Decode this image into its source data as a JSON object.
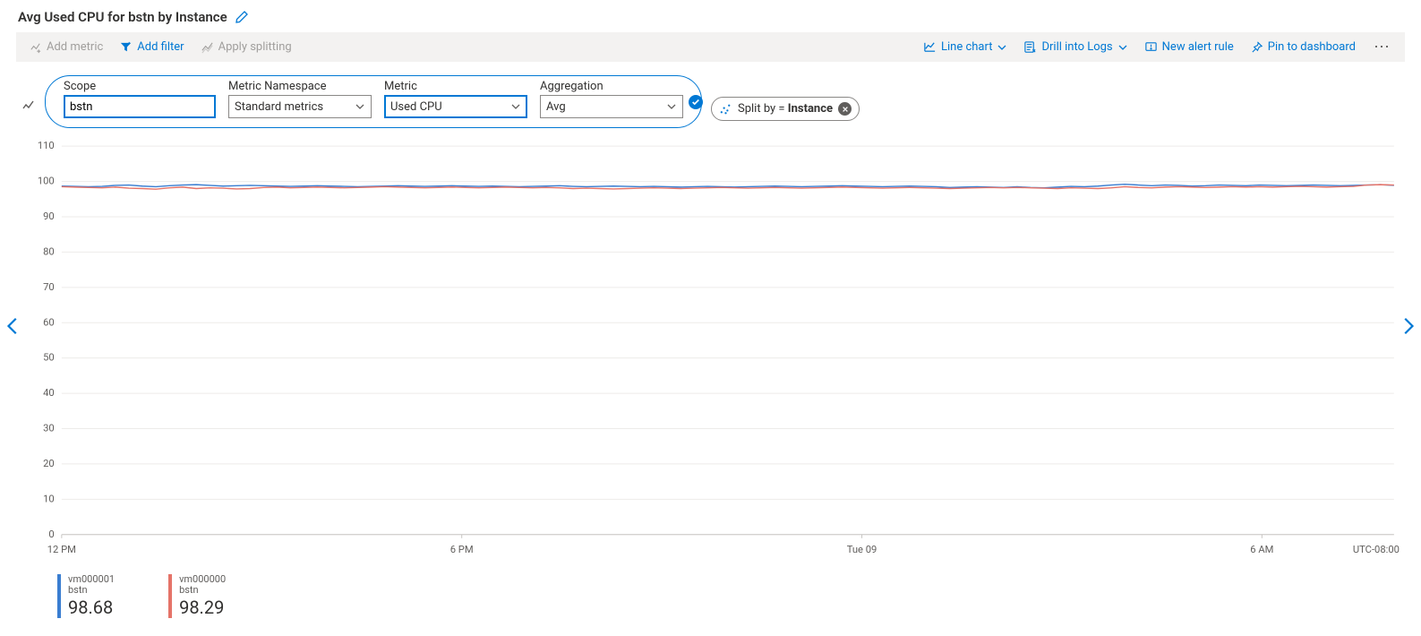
{
  "title": "Avg Used CPU for bstn by Instance",
  "toolbar": {
    "add_metric": "Add metric",
    "add_filter": "Add filter",
    "apply_splitting": "Apply splitting",
    "line_chart": "Line chart",
    "drill_logs": "Drill into Logs",
    "new_alert": "New alert rule",
    "pin_dashboard": "Pin to dashboard"
  },
  "config": {
    "scope_label": "Scope",
    "scope_value": "bstn",
    "namespace_label": "Metric Namespace",
    "namespace_value": "Standard metrics",
    "metric_label": "Metric",
    "metric_value": "Used CPU",
    "aggregation_label": "Aggregation",
    "aggregation_value": "Avg"
  },
  "split": {
    "prefix": "Split by = ",
    "value": "Instance"
  },
  "timezone": "UTC-08:00",
  "chart_data": {
    "type": "line",
    "title": "Avg Used CPU for bstn by Instance",
    "xlabel": "",
    "ylabel": "",
    "ylim": [
      0,
      110
    ],
    "y_ticks": [
      0,
      10,
      20,
      30,
      40,
      50,
      60,
      70,
      80,
      90,
      100,
      110
    ],
    "x_ticks": [
      "12 PM",
      "6 PM",
      "Tue 09",
      "6 AM"
    ],
    "x_range_hours": 24,
    "series": [
      {
        "name": "vm000001",
        "resource": "bstn",
        "color": "#3a7ed1",
        "avg": 98.68,
        "values": [
          98.7,
          98.6,
          98.5,
          98.6,
          98.9,
          99.0,
          98.7,
          98.5,
          98.8,
          99.0,
          99.1,
          98.9,
          98.7,
          98.8,
          98.9,
          98.8,
          98.7,
          98.6,
          98.7,
          98.8,
          98.7,
          98.6,
          98.5,
          98.6,
          98.7,
          98.8,
          98.7,
          98.6,
          98.7,
          98.8,
          98.7,
          98.6,
          98.7,
          98.6,
          98.5,
          98.6,
          98.7,
          98.8,
          98.6,
          98.5,
          98.6,
          98.7,
          98.6,
          98.5,
          98.6,
          98.5,
          98.4,
          98.5,
          98.6,
          98.5,
          98.4,
          98.5,
          98.6,
          98.7,
          98.6,
          98.5,
          98.6,
          98.7,
          98.8,
          98.7,
          98.6,
          98.5,
          98.6,
          98.7,
          98.6,
          98.5,
          98.3,
          98.4,
          98.5,
          98.4,
          98.3,
          98.5,
          98.3,
          98.2,
          98.4,
          98.6,
          98.5,
          98.7,
          99.0,
          99.2,
          99.0,
          98.8,
          99.0,
          98.9,
          98.7,
          98.8,
          99.0,
          98.9,
          98.8,
          99.0,
          98.9,
          98.8,
          98.9,
          99.0,
          98.9,
          98.8,
          98.9,
          99.0,
          99.1,
          98.9
        ]
      },
      {
        "name": "vm000000",
        "resource": "bstn",
        "color": "#e57368",
        "avg": 98.29,
        "values": [
          98.5,
          98.4,
          98.3,
          98.2,
          98.4,
          98.1,
          98.0,
          97.8,
          98.2,
          98.4,
          98.0,
          98.2,
          98.1,
          97.9,
          98.0,
          98.3,
          98.4,
          98.2,
          98.3,
          98.4,
          98.3,
          98.2,
          98.3,
          98.4,
          98.5,
          98.4,
          98.3,
          98.2,
          98.3,
          98.4,
          98.3,
          98.2,
          98.3,
          98.4,
          98.3,
          98.2,
          98.3,
          98.2,
          98.0,
          98.1,
          98.0,
          97.9,
          98.0,
          98.1,
          98.2,
          98.1,
          98.0,
          98.1,
          98.2,
          98.3,
          98.2,
          98.1,
          98.2,
          98.3,
          98.2,
          98.1,
          98.2,
          98.3,
          98.4,
          98.3,
          98.2,
          98.1,
          98.2,
          98.3,
          98.2,
          98.1,
          98.0,
          98.1,
          98.2,
          98.3,
          98.2,
          98.3,
          98.2,
          98.1,
          98.0,
          98.2,
          98.1,
          98.0,
          98.2,
          98.5,
          98.3,
          98.2,
          98.4,
          98.5,
          98.4,
          98.3,
          98.4,
          98.5,
          98.4,
          98.5,
          98.4,
          98.5,
          98.6,
          98.5,
          98.4,
          98.5,
          98.6,
          99.0,
          99.1,
          99.0
        ]
      }
    ]
  },
  "legend": [
    {
      "name": "vm000001",
      "resource": "bstn",
      "value": "98.68",
      "color": "#3a7ed1"
    },
    {
      "name": "vm000000",
      "resource": "bstn",
      "value": "98.29",
      "color": "#e57368"
    }
  ]
}
